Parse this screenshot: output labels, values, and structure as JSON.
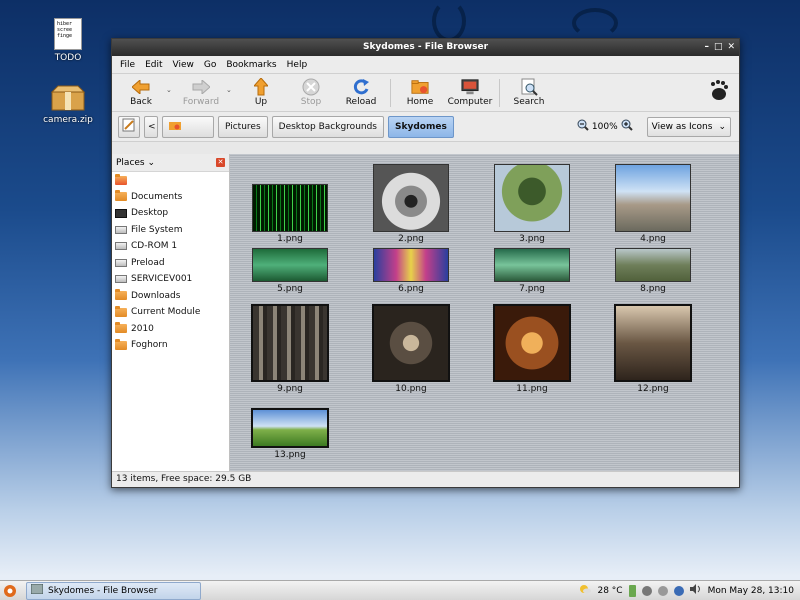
{
  "desktop": {
    "icons": [
      {
        "label": "TODO",
        "doc_lines": [
          "hiber",
          "scree",
          "finge"
        ]
      },
      {
        "label": "camera.zip"
      }
    ]
  },
  "window": {
    "title": "Skydomes - File Browser",
    "controls": [
      "–",
      "□",
      "✕"
    ]
  },
  "menu": [
    "File",
    "Edit",
    "View",
    "Go",
    "Bookmarks",
    "Help"
  ],
  "toolbar": {
    "back": "Back",
    "forward": "Forward",
    "up": "Up",
    "stop": "Stop",
    "reload": "Reload",
    "home": "Home",
    "computer": "Computer",
    "search": "Search"
  },
  "location": {
    "back_arrow": "<",
    "crumbs": [
      "Pictures",
      "Desktop Backgrounds",
      "Skydomes"
    ],
    "zoom_level": "100%",
    "view_mode": "View as Icons"
  },
  "sidebar": {
    "header": "Places",
    "items": [
      {
        "label": "",
        "icon": "home-folder"
      },
      {
        "label": "Documents",
        "icon": "folder"
      },
      {
        "label": "Desktop",
        "icon": "desktop"
      },
      {
        "label": "File System",
        "icon": "drive"
      },
      {
        "label": "CD-ROM 1",
        "icon": "drive"
      },
      {
        "label": "Preload",
        "icon": "drive"
      },
      {
        "label": "SERVICEV001",
        "icon": "drive"
      },
      {
        "label": "Downloads",
        "icon": "folder"
      },
      {
        "label": "Current Module",
        "icon": "folder"
      },
      {
        "label": "2010",
        "icon": "folder"
      },
      {
        "label": "Foghorn",
        "icon": "folder"
      }
    ]
  },
  "files": [
    {
      "name": "1.png"
    },
    {
      "name": "2.png"
    },
    {
      "name": "3.png"
    },
    {
      "name": "4.png"
    },
    {
      "name": "5.png"
    },
    {
      "name": "6.png"
    },
    {
      "name": "7.png"
    },
    {
      "name": "8.png"
    },
    {
      "name": "9.png"
    },
    {
      "name": "10.png"
    },
    {
      "name": "11.png"
    },
    {
      "name": "12.png"
    },
    {
      "name": "13.png"
    }
  ],
  "status": "13 items, Free space: 29.5 GB",
  "panel": {
    "task": "Skydomes - File Browser",
    "temperature": "28 °C",
    "clock": "Mon May 28, 13:10"
  },
  "colors": {
    "accent": "#8db6e8",
    "titlebar": "#2a2a2a",
    "folder": "#e28b25"
  }
}
